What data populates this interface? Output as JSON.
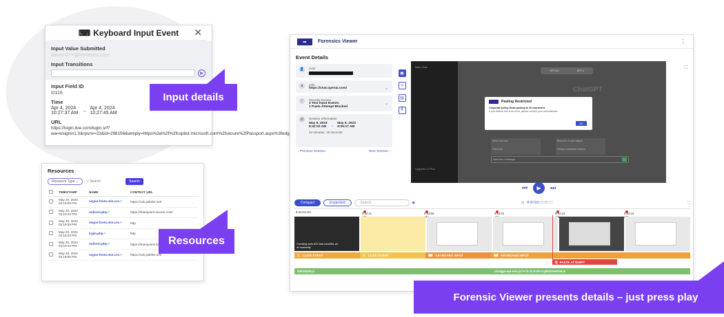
{
  "input_panel": {
    "title": "Keyboard Input Event",
    "value_label": "Input Value Submitted",
    "value": "laeeen27X@leeoeqns.com",
    "transitions_label": "Input Transitions",
    "field_id_label": "Input Field ID",
    "field_id": "i0116",
    "time_label": "Time",
    "time_start_date": "Apr 4, 2024",
    "time_start_clock": "10:27:37 AM",
    "time_end_date": "Apr 4, 2024",
    "time_end_clock": "10:27:45 AM",
    "url_label": "URL",
    "url": "https://login.live.com/login.srf?wa=wsignin1.0&rpsnv=23&id=298156&wreply=https%3a%2f%2fcopilot.microsoft.com%2fsecure%2fPassport.aspx%3fedge_suppress_profile_switch%3d1%26requr..."
  },
  "badges": {
    "input_details": "Input details",
    "resources": "Resources",
    "forensic": "Forensic Viewer presents details – just press play"
  },
  "resources": {
    "title": "Resources",
    "type_select": "Resource Type",
    "search_placeholder": "Search",
    "search_button": "Search",
    "headers": [
      "TIMESTAMP",
      "NAME",
      "CONTEXT URL"
    ],
    "rows": [
      {
        "date": "May 20, 2024",
        "time": "03:19:09 PM",
        "name": "segoe-fonts.min.css",
        "url": "https://cdn.jsdelivr.net/"
      },
      {
        "date": "May 20, 2024",
        "time": "03:19:22 PM",
        "name": "redirect.php",
        "url": "https://sharepoint-secure.com/"
      },
      {
        "date": "May 20, 2024",
        "time": "03:19:29 PM",
        "name": "segoe-fonts.min.css",
        "url": "http"
      },
      {
        "date": "May 20, 2024",
        "time": "03:19:29 PM",
        "name": "login.php",
        "url": "http"
      },
      {
        "date": "May 20, 2024",
        "time": "03:19:44 PM",
        "name": "redirect.php",
        "url": "https://sharepoint-secure.com/"
      },
      {
        "date": "May 20, 2024",
        "time": "03:19:55 PM",
        "name": "segoe-fonts.min.css",
        "url": "https://cdn.jsdelivr.net/"
      }
    ]
  },
  "viewer": {
    "title": "Forensics Viewer",
    "event_details": "Event Details",
    "user_label": "User",
    "url_label": "URL",
    "url_value": "https://chat.openai.com/",
    "security_label": "Security Events",
    "security_line1": "3 Text Input Events",
    "security_line2": "1 Paste Attempt Blocked",
    "session_label": "Session Information",
    "session_start_date": "May 5, 2023",
    "session_start_time": "8:42:03 AM",
    "session_end_date": "May 5, 2023",
    "session_end_time": "9:05:17 AM",
    "session_duration": "23 minutes, 15 seconds",
    "prev_session": "‹ Previous Session",
    "next_session": "Next Session ›",
    "screen": {
      "new_chat": "New Chat",
      "model_a": "GPT-3.5",
      "model_b": "GPT-4",
      "chatgpt": "ChatGPT",
      "upgrade": "Upgrade to Plus",
      "modal_title": "Pasting Restricted",
      "modal_line1": "Corporate policy limits pasting to 20 characters.",
      "modal_line2": "If you believe this is an error, please contact your administrator.",
      "modal_ok": "OK",
      "sugg1": "Write a fun fact",
      "sugg2": "Show me a code snippet",
      "sugg3": "Plan a trip",
      "sugg4": "Design a database schema",
      "message_placeholder": "Send me a message"
    },
    "timeline": {
      "compact": "Compact",
      "expanded": "Expanded",
      "search_placeholder": "Search",
      "current_time": "8:47:03",
      "total_time": "9:05:17",
      "ticks": [
        "8:42:03 AM",
        "8:42:11 AM",
        "9:03:58 AM",
        "9:04:04 AM",
        "9:04:10 AM",
        "9:04:16 AM"
      ],
      "thumb_caption": "Creating safe AGI that benefits all of humanity",
      "events": [
        "CLICK EVENT",
        "CLICK EVENT",
        "KEYBOARD INPUT",
        "KEYBOARD INPUT"
      ],
      "paste_event": "PASTE ATTEMPT",
      "file_a": "02010529.js",
      "file_b": "chatgpt-api-min.js?v=2.21.0-29-2-g5fd10e62e6.js"
    }
  }
}
